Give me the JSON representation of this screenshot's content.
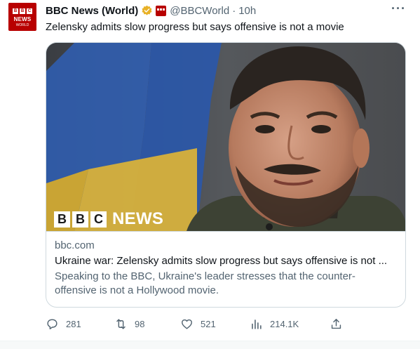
{
  "tweet": {
    "author": {
      "display_name": "BBC News (World)",
      "handle": "@BBCWorld",
      "separator": "·",
      "time": "10h",
      "avatar_text": {
        "b1": "B",
        "b2": "B",
        "b3": "C",
        "news": "NEWS",
        "world": "WORLD"
      },
      "verified_icon": "gold-verified-badge-icon",
      "affiliation_icon": "bbc-affiliation-icon"
    },
    "more_label": "···",
    "text": "Zelensky admits slow progress but says offensive is not a movie",
    "card": {
      "image_logo": {
        "b1": "B",
        "b2": "B",
        "b3": "C",
        "news": "NEWS"
      },
      "domain": "bbc.com",
      "title": "Ukraine war: Zelensky admits slow progress but says offensive is not ...",
      "description": "Speaking to the BBC, Ukraine's leader stresses that the counter-offensive is not a Hollywood movie."
    },
    "actions": {
      "replies": "281",
      "retweets": "98",
      "likes": "521",
      "views": "214.1K"
    }
  },
  "colors": {
    "bbc_red": "#b80000",
    "text_primary": "#0f1419",
    "text_secondary": "#536471",
    "border": "#cfd9de",
    "verified_gold": "#e8b127"
  }
}
